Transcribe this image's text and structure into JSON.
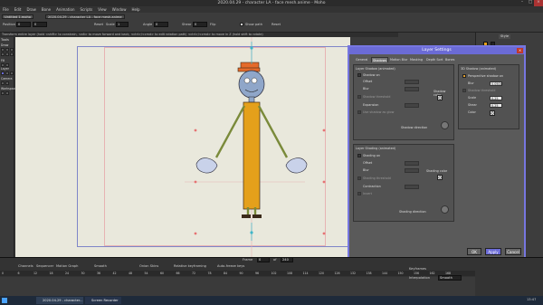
{
  "window": {
    "title": "2020.04.29 - character LA - face mesh.anime - Moho"
  },
  "menu": [
    "File",
    "Edit",
    "Draw",
    "Bone",
    "Animation",
    "Scripts",
    "View",
    "Window",
    "Help"
  ],
  "toolbar": {
    "doc_tab": "Untitled 1.moho",
    "doc_tab2": "2020.04.29 - character LA - face mesh.anime",
    "position_label": "Position",
    "position_x": "0",
    "position_y": "0",
    "reset_label": "Reset",
    "scale_label": "Scale",
    "scale_value": "1",
    "angle_label": "Angle",
    "angle_value": "0",
    "shear_label": "Shear",
    "shear_value": "0",
    "flip_label": "Flip",
    "show_path_label": "Show path",
    "reset2_label": "Reset"
  },
  "hint": "Transform entire layer (hold <shift> to constrain, <alt> to move forward and back, <ctrl>/<cmd> to edit rotation path) <ctrl>/<cmd> to move in Z (hold shift to rotate)",
  "tools_panel": {
    "title": "Tools",
    "sections": [
      "Draw",
      "Fill",
      "Layer",
      "Camera",
      "Workspace"
    ]
  },
  "right_panel": {
    "style_tab": "Style",
    "layers_tab": "Layers"
  },
  "dialog": {
    "title": "Layer Settings",
    "close": "×",
    "tabs": [
      "General",
      "Shadows",
      "Motion Blur",
      "Masking",
      "Depth Sort",
      "Bones"
    ],
    "active_tab": "Shadows",
    "shadow": {
      "group_label": "Layer Shadow (animated)",
      "shadow_on": "Shadow on",
      "offset": "Offset",
      "blur": "Blur",
      "expansion": "Expansion",
      "shadow_color": "Shadow color",
      "threshold": "Shadow threshold",
      "noise": "Noise",
      "direction": "Shadow direction",
      "as_shadow": "Use shadow as glow"
    },
    "shading": {
      "group_label": "Layer Shading (animated)",
      "shading_on": "Shading on",
      "offset": "Offset",
      "blur": "Blur",
      "threshold": "Shading threshold",
      "contraction": "Contraction",
      "invert": "Invert",
      "shading_color": "Shading color",
      "direction": "Shading direction"
    },
    "threed": {
      "group_label": "3D Shadow (animated)",
      "perspective": "Perspective shadow on",
      "blur": "Blur",
      "blur_value": "0.0500",
      "shadow_threshold": "Shadow threshold",
      "scale": "Scale",
      "scale_value": "0.25",
      "shear": "Shear",
      "shear_value": "0.25",
      "color": "Color"
    },
    "buttons": {
      "ok": "OK",
      "apply": "Apply",
      "cancel": "Cancel"
    }
  },
  "timeline": {
    "tabs": [
      "Channels",
      "Sequencer",
      "Motion Graph"
    ],
    "smooth": "Smooth",
    "onion_label": "Onion Skins",
    "relative_kf": "Relative keyframing",
    "auto_freeze": "Auto-freeze keys",
    "frame_label": "Frame",
    "frame_value": "0",
    "of_label": "of",
    "of_value": "240",
    "ticks": [
      "0",
      "6",
      "12",
      "18",
      "24",
      "30",
      "36",
      "42",
      "48",
      "54",
      "60",
      "66",
      "72",
      "78",
      "84",
      "90",
      "96",
      "102",
      "108",
      "114",
      "120",
      "126",
      "132",
      "138",
      "144",
      "150",
      "156",
      "162",
      "168"
    ],
    "keyframes_label": "Keyframes",
    "interpolation": "Interpolation",
    "smooth_value": "Smooth"
  },
  "taskbar": {
    "items": [
      "2020.04.29 - character...",
      "Screen Recorder"
    ],
    "time": "13:47"
  },
  "colors": {
    "dialog_accent": "#6b6bd6",
    "canvas_bg": "#e9e8dc",
    "character_body": "#e4a01b",
    "hat": "#e56a2a",
    "skin": "#8fa6c9"
  }
}
